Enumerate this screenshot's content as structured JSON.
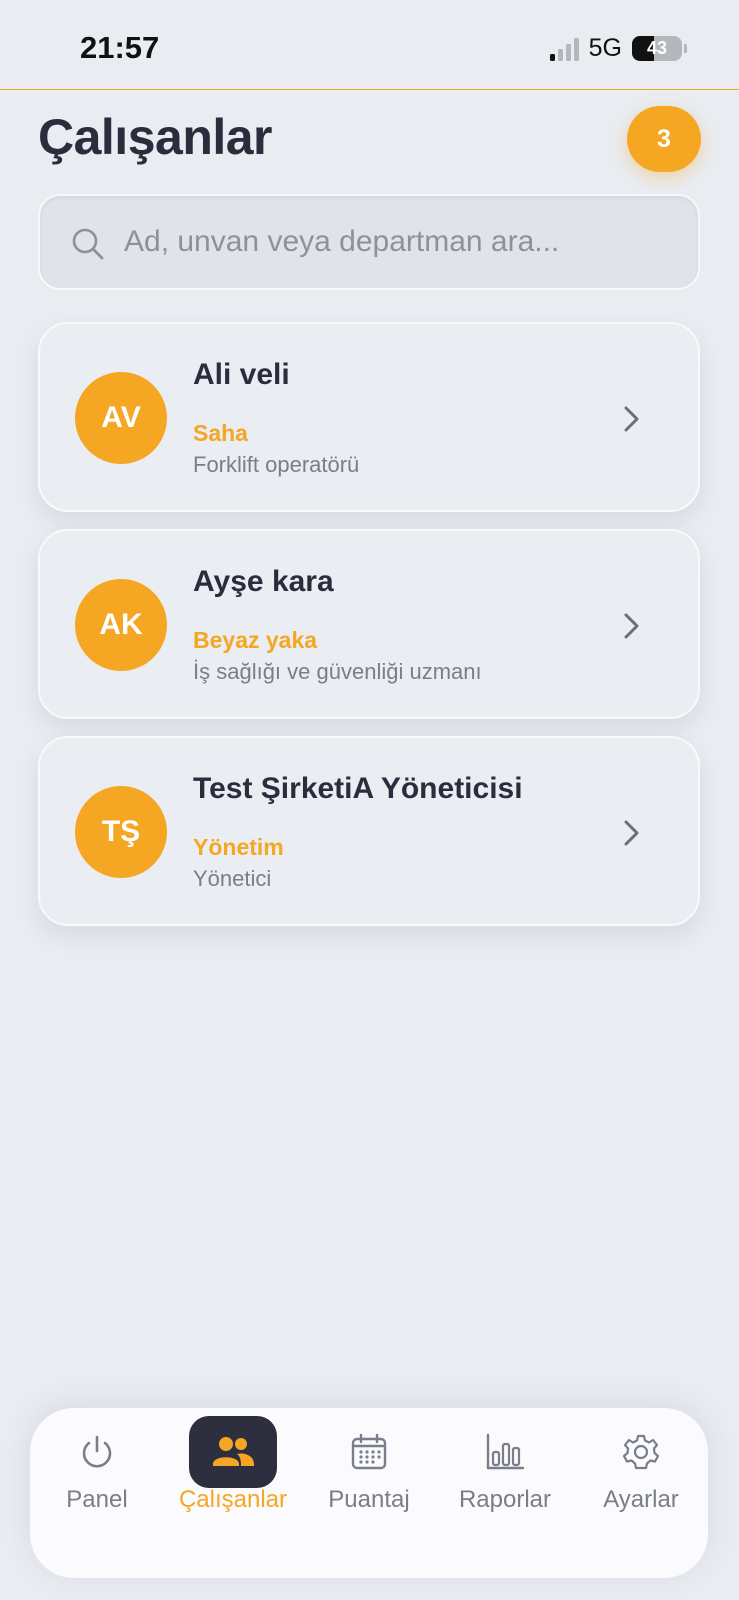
{
  "status_bar": {
    "time": "21:57",
    "network": "5G",
    "battery": "43"
  },
  "header": {
    "title": "Çalışanlar",
    "count_badge": "3"
  },
  "search": {
    "placeholder": "Ad, unvan veya departman ara...",
    "value": ""
  },
  "employees": [
    {
      "initials": "AV",
      "name": "Ali veli",
      "department": "Saha",
      "title": "Forklift operatörü"
    },
    {
      "initials": "AK",
      "name": "Ayşe kara",
      "department": "Beyaz yaka",
      "title": "İş sağlığı ve güvenliği uzmanı"
    },
    {
      "initials": "TŞ",
      "name": "Test ŞirketiA Yöneticisi",
      "department": "Yönetim",
      "title": "Yönetici"
    }
  ],
  "bottom_nav": {
    "items": [
      {
        "label": "Panel",
        "icon": "power-icon"
      },
      {
        "label": "Çalışanlar",
        "icon": "users-icon",
        "active": true
      },
      {
        "label": "Puantaj",
        "icon": "calendar-icon"
      },
      {
        "label": "Raporlar",
        "icon": "bar-chart-icon"
      },
      {
        "label": "Ayarlar",
        "icon": "gear-icon"
      }
    ]
  },
  "colors": {
    "accent": "#f5a623",
    "dark": "#2d2f3f",
    "background": "#e9ecf1"
  }
}
